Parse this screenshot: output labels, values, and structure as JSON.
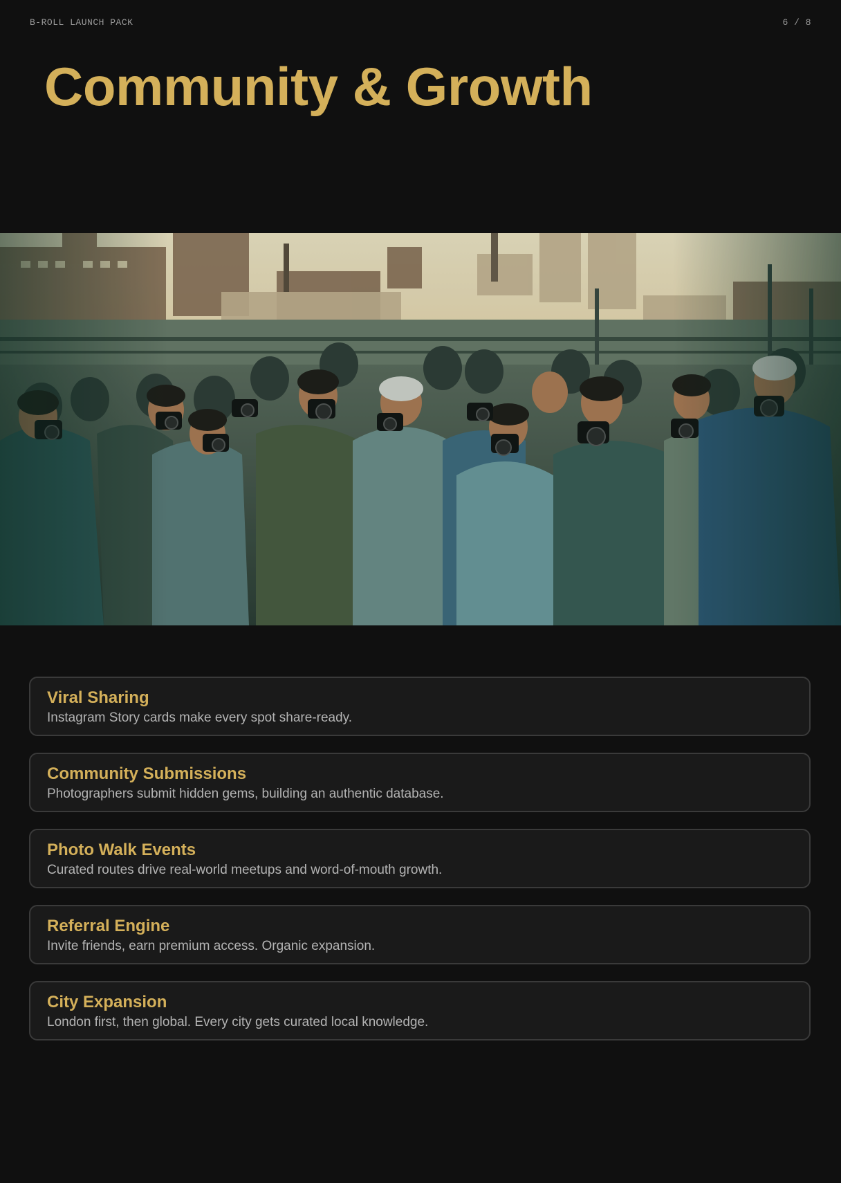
{
  "header": {
    "deck_label": "B-ROLL LAUNCH PACK",
    "page_indicator": "6 / 8"
  },
  "title": "Community & Growth",
  "hero_image": {
    "subject": "group of photographers holding cameras in an industrial setting at golden hour"
  },
  "features": [
    {
      "title": "Viral Sharing",
      "description": "Instagram Story cards make every spot share-ready."
    },
    {
      "title": "Community Submissions",
      "description": "Photographers submit hidden gems, building an authentic database."
    },
    {
      "title": "Photo Walk Events",
      "description": "Curated routes drive real-world meetups and word-of-mouth growth."
    },
    {
      "title": "Referral Engine",
      "description": "Invite friends, earn premium access. Organic expansion."
    },
    {
      "title": "City Expansion",
      "description": "London first, then global. Every city gets curated local knowledge."
    }
  ],
  "colors": {
    "background": "#101010",
    "accent": "#d4b05a",
    "card_background": "#1a1a1a",
    "card_border": "#3a3a3a",
    "body_text": "#b4b4b4"
  }
}
